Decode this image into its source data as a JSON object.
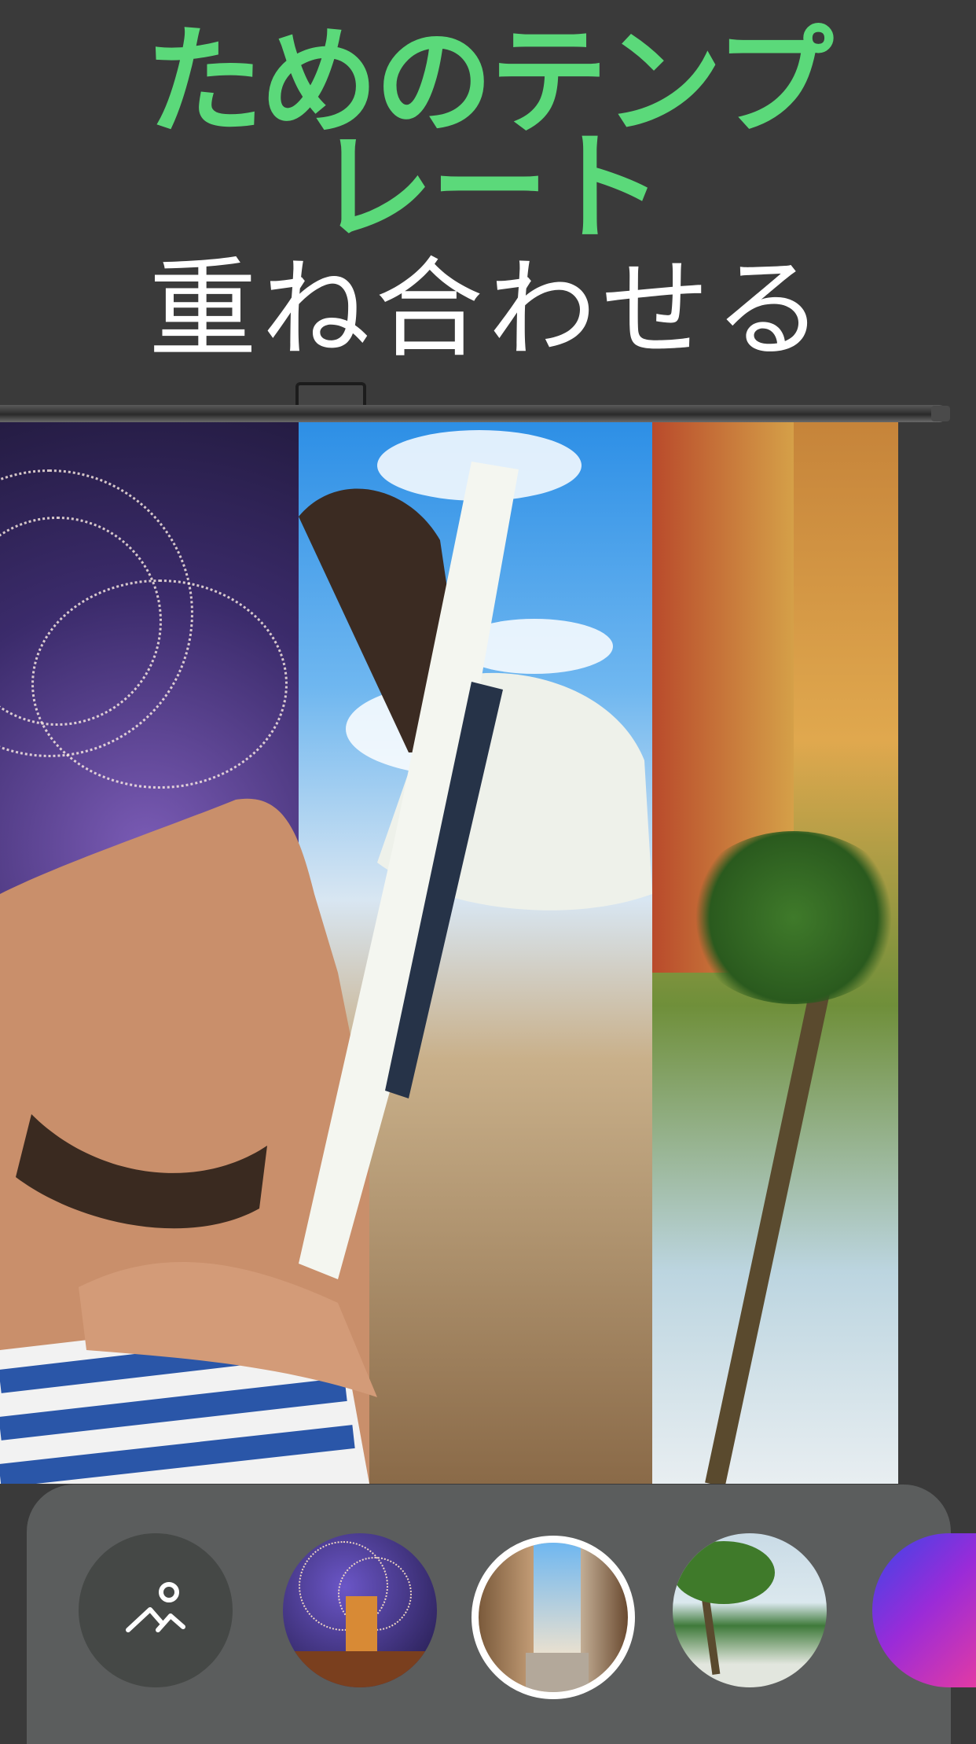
{
  "header": {
    "title_line1": "ためのテンプ",
    "title_line2": "レート",
    "subtitle": "重ね合わせる"
  },
  "colors": {
    "title_green": "#5bd97a",
    "background": "#3a3a3a",
    "bottom_bar": "#5b5d5d"
  },
  "bottom_bar": {
    "add_photo_icon": "add-photo-icon",
    "templates": [
      {
        "name": "fireworks-bridge",
        "selected": false
      },
      {
        "name": "old-town-street",
        "selected": true
      },
      {
        "name": "palm-beach",
        "selected": false
      },
      {
        "name": "neon-tunnel",
        "selected": false
      }
    ]
  }
}
